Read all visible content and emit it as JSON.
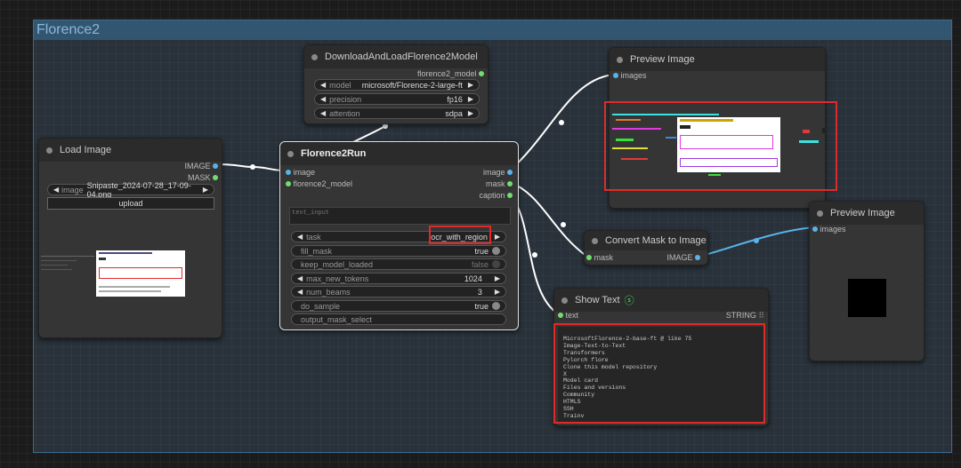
{
  "group": {
    "title": "Florence2"
  },
  "download_node": {
    "title": "DownloadAndLoadFlorence2Model",
    "output": "florence2_model",
    "widgets": [
      {
        "label": "model",
        "value": "microsoft/Florence-2-large-ft"
      },
      {
        "label": "precision",
        "value": "fp16"
      },
      {
        "label": "attention",
        "value": "sdpa"
      }
    ]
  },
  "load_image_node": {
    "title": "Load Image",
    "outputs": [
      "IMAGE",
      "MASK"
    ],
    "image_label": "image",
    "image_value": "Snipaste_2024-07-28_17-09-04.png",
    "upload_label": "upload"
  },
  "florence_run_node": {
    "title": "Florence2Run",
    "inputs": [
      "image",
      "florence2_model"
    ],
    "outputs": [
      "image",
      "mask",
      "caption"
    ],
    "text_input_placeholder": "text_input",
    "widgets": [
      {
        "label": "task",
        "value": "ocr_with_region"
      },
      {
        "label": "fill_mask",
        "value": "true"
      },
      {
        "label": "keep_model_loaded",
        "value": "false"
      },
      {
        "label": "max_new_tokens",
        "value": "1024"
      },
      {
        "label": "num_beams",
        "value": "3"
      },
      {
        "label": "do_sample",
        "value": "true"
      },
      {
        "label": "output_mask_select",
        "value": ""
      }
    ]
  },
  "preview_image_1": {
    "title": "Preview Image",
    "input": "images"
  },
  "preview_image_2": {
    "title": "Preview Image",
    "input": "images"
  },
  "convert_mask_node": {
    "title": "Convert Mask to Image",
    "input": "mask",
    "output": "IMAGE"
  },
  "show_text_node": {
    "title": "Show Text",
    "input": "text",
    "output": "STRING",
    "lines": [
      "MicrosoftFlorence-2-base-ft @ like 75",
      "Image-Text-to-Text",
      "Transformers",
      "Pylorch flore",
      "Clone this model repository",
      "X",
      "Model card",
      "Files and versions",
      "Community",
      "HTMLS",
      "SSH",
      "Trainv"
    ]
  },
  "colors": {
    "accent_red": "#e02a2a",
    "link_white": "#ffffff",
    "link_blue": "#5ab3e8",
    "group_blue": "#335670"
  }
}
